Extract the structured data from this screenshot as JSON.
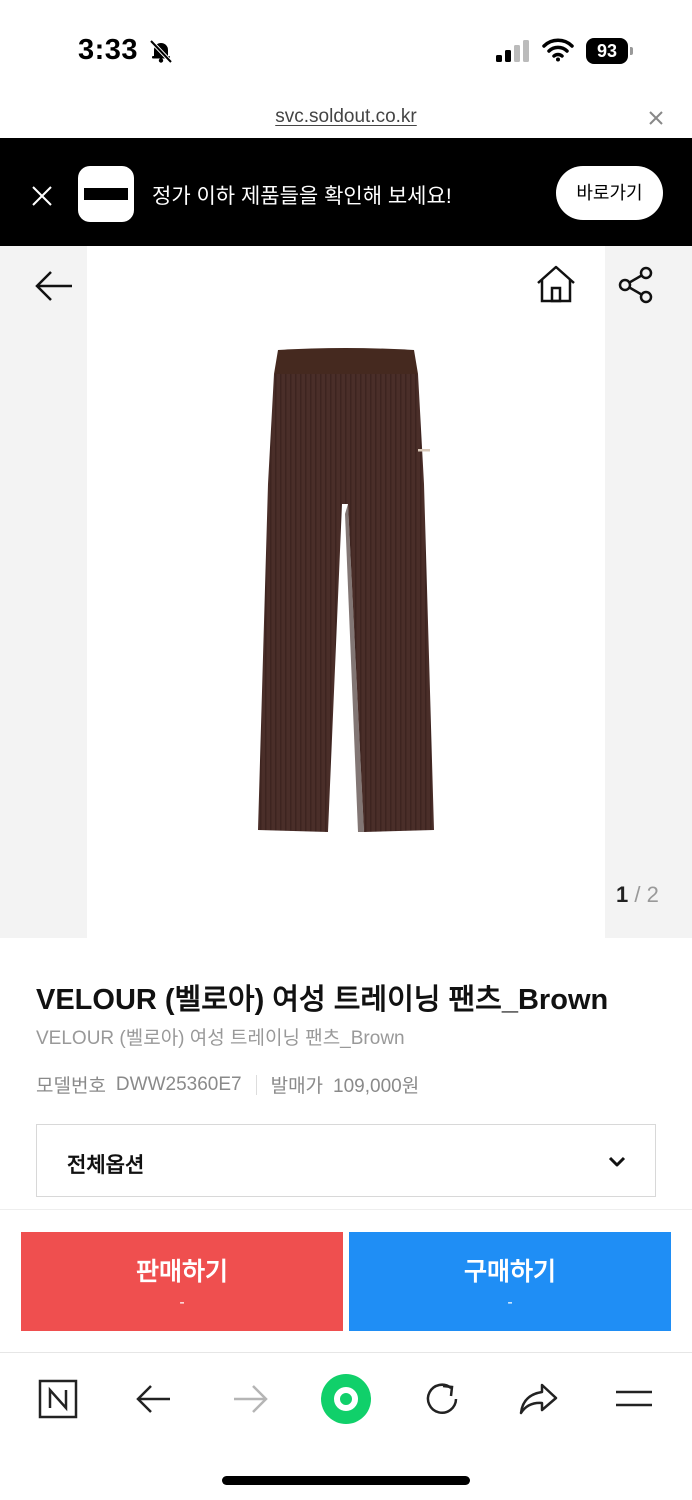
{
  "status_bar": {
    "time": "3:33",
    "battery": "93",
    "icons": [
      "bell-off-icon",
      "signal-icon",
      "wifi-icon",
      "battery-icon"
    ]
  },
  "url_bar": {
    "url": "svc.soldout.co.kr",
    "close_icon": "close-icon"
  },
  "promo_banner": {
    "text": "정가 이하 제품들을 확인해 보세요!",
    "button_label": "바로가기",
    "close_icon": "close-icon"
  },
  "gallery": {
    "current_page": "1",
    "separator": "/",
    "total_pages": "2",
    "icons": [
      "back-arrow-icon",
      "home-icon",
      "share-icon"
    ],
    "product_color": "#4a2e29"
  },
  "product": {
    "title": "VELOUR (벨로아) 여성 트레이닝 팬츠_Brown",
    "subtitle": "VELOUR (벨로아) 여성 트레이닝 팬츠_Brown",
    "model_label": "모델번호",
    "model_value": "DWW25360E7",
    "release_price_label": "발매가",
    "release_price_value": "109,000원"
  },
  "options": {
    "label": "전체옵션",
    "icon": "chevron-down-icon"
  },
  "actions": {
    "sell_label": "판매하기",
    "sell_price": "-",
    "buy_label": "구매하기",
    "buy_price": "-",
    "sell_color": "#ef4f4f",
    "buy_color": "#1f8ef5"
  },
  "browser_toolbar": {
    "icons": [
      "naver-icon",
      "back-icon",
      "forward-icon",
      "home-icon",
      "reload-icon",
      "share-icon",
      "menu-icon"
    ],
    "accent": "#10d06a"
  }
}
